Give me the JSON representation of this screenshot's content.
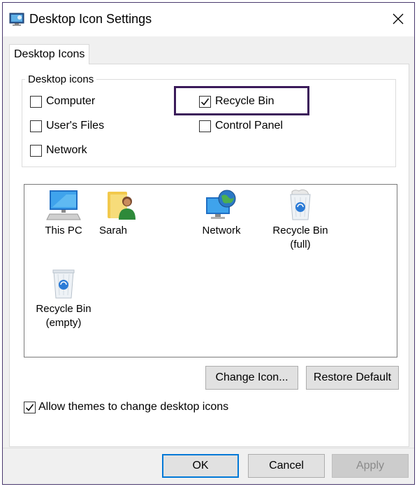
{
  "window": {
    "title": "Desktop Icon Settings",
    "icon": "desktop-settings-icon"
  },
  "tabs": [
    {
      "label": "Desktop Icons",
      "selected": true
    }
  ],
  "group": {
    "label": "Desktop icons",
    "checkboxes": [
      {
        "label": "Computer",
        "checked": false
      },
      {
        "label": "Recycle Bin",
        "checked": true
      },
      {
        "label": "User's Files",
        "checked": false
      },
      {
        "label": "Control Panel",
        "checked": false
      },
      {
        "label": "Network",
        "checked": false
      }
    ]
  },
  "icons": [
    {
      "label": "This PC",
      "icon": "computer-icon"
    },
    {
      "label": "Sarah",
      "icon": "user-folder-icon"
    },
    {
      "label": "Network",
      "icon": "network-globe-icon"
    },
    {
      "label": "Recycle Bin\n(full)",
      "icon": "recycle-bin-full-icon"
    },
    {
      "label": "Recycle Bin\n(empty)",
      "icon": "recycle-bin-empty-icon"
    }
  ],
  "buttons": {
    "change_icon": "Change Icon...",
    "restore_default": "Restore Default",
    "ok": "OK",
    "cancel": "Cancel",
    "apply": "Apply"
  },
  "allow_themes": {
    "label": "Allow themes to change desktop icons",
    "checked": true
  },
  "colors": {
    "highlight_border": "#3b1b5a",
    "default_button_border": "#0078d7"
  }
}
